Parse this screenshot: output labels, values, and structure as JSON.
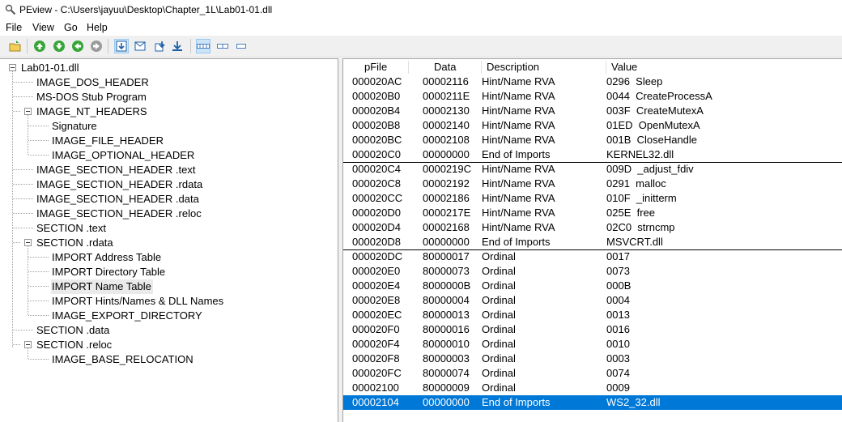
{
  "window": {
    "title": "PEview - C:\\Users\\jayuu\\Desktop\\Chapter_1L\\Lab01-01.dll"
  },
  "menu": [
    "File",
    "View",
    "Go",
    "Help"
  ],
  "toolbar": {
    "icons": [
      "open-icon",
      "home-icon",
      "down-icon",
      "back-icon",
      "forward-icon",
      "view-bytes-icon",
      "view-words-icon",
      "view-dwords-icon",
      "view-qwords-icon",
      "layout-wide-icon",
      "layout-medium-icon",
      "layout-narrow-icon"
    ]
  },
  "tree": {
    "root": "Lab01-01.dll",
    "items": [
      {
        "label": "IMAGE_DOS_HEADER",
        "level": 1
      },
      {
        "label": "MS-DOS Stub Program",
        "level": 1
      },
      {
        "label": "IMAGE_NT_HEADERS",
        "level": 1,
        "expanded": true
      },
      {
        "label": "Signature",
        "level": 2
      },
      {
        "label": "IMAGE_FILE_HEADER",
        "level": 2
      },
      {
        "label": "IMAGE_OPTIONAL_HEADER",
        "level": 2
      },
      {
        "label": "IMAGE_SECTION_HEADER .text",
        "level": 1
      },
      {
        "label": "IMAGE_SECTION_HEADER .rdata",
        "level": 1
      },
      {
        "label": "IMAGE_SECTION_HEADER .data",
        "level": 1
      },
      {
        "label": "IMAGE_SECTION_HEADER .reloc",
        "level": 1
      },
      {
        "label": "SECTION .text",
        "level": 1
      },
      {
        "label": "SECTION .rdata",
        "level": 1,
        "expanded": true
      },
      {
        "label": "IMPORT Address Table",
        "level": 2
      },
      {
        "label": "IMPORT Directory Table",
        "level": 2
      },
      {
        "label": "IMPORT Name Table",
        "level": 2,
        "selected": true
      },
      {
        "label": "IMPORT Hints/Names & DLL Names",
        "level": 2
      },
      {
        "label": "IMAGE_EXPORT_DIRECTORY",
        "level": 2
      },
      {
        "label": "SECTION .data",
        "level": 1
      },
      {
        "label": "SECTION .reloc",
        "level": 1,
        "expanded": true
      },
      {
        "label": "IMAGE_BASE_RELOCATION",
        "level": 2
      }
    ]
  },
  "columns": [
    "pFile",
    "Data",
    "Description",
    "Value"
  ],
  "rows": [
    {
      "pfile": "000020AC",
      "data": "00002116",
      "desc": "Hint/Name RVA",
      "value": "0296  Sleep"
    },
    {
      "pfile": "000020B0",
      "data": "0000211E",
      "desc": "Hint/Name RVA",
      "value": "0044  CreateProcessA"
    },
    {
      "pfile": "000020B4",
      "data": "00002130",
      "desc": "Hint/Name RVA",
      "value": "003F  CreateMutexA"
    },
    {
      "pfile": "000020B8",
      "data": "00002140",
      "desc": "Hint/Name RVA",
      "value": "01ED  OpenMutexA"
    },
    {
      "pfile": "000020BC",
      "data": "00002108",
      "desc": "Hint/Name RVA",
      "value": "001B  CloseHandle"
    },
    {
      "pfile": "000020C0",
      "data": "00000000",
      "desc": "End of Imports",
      "value": "KERNEL32.dll",
      "group_end": true
    },
    {
      "pfile": "000020C4",
      "data": "0000219C",
      "desc": "Hint/Name RVA",
      "value": "009D  _adjust_fdiv"
    },
    {
      "pfile": "000020C8",
      "data": "00002192",
      "desc": "Hint/Name RVA",
      "value": "0291  malloc"
    },
    {
      "pfile": "000020CC",
      "data": "00002186",
      "desc": "Hint/Name RVA",
      "value": "010F  _initterm"
    },
    {
      "pfile": "000020D0",
      "data": "0000217E",
      "desc": "Hint/Name RVA",
      "value": "025E  free"
    },
    {
      "pfile": "000020D4",
      "data": "00002168",
      "desc": "Hint/Name RVA",
      "value": "02C0  strncmp"
    },
    {
      "pfile": "000020D8",
      "data": "00000000",
      "desc": "End of Imports",
      "value": "MSVCRT.dll",
      "group_end": true
    },
    {
      "pfile": "000020DC",
      "data": "80000017",
      "desc": "Ordinal",
      "value": "0017"
    },
    {
      "pfile": "000020E0",
      "data": "80000073",
      "desc": "Ordinal",
      "value": "0073"
    },
    {
      "pfile": "000020E4",
      "data": "8000000B",
      "desc": "Ordinal",
      "value": "000B"
    },
    {
      "pfile": "000020E8",
      "data": "80000004",
      "desc": "Ordinal",
      "value": "0004"
    },
    {
      "pfile": "000020EC",
      "data": "80000013",
      "desc": "Ordinal",
      "value": "0013"
    },
    {
      "pfile": "000020F0",
      "data": "80000016",
      "desc": "Ordinal",
      "value": "0016"
    },
    {
      "pfile": "000020F4",
      "data": "80000010",
      "desc": "Ordinal",
      "value": "0010"
    },
    {
      "pfile": "000020F8",
      "data": "80000003",
      "desc": "Ordinal",
      "value": "0003"
    },
    {
      "pfile": "000020FC",
      "data": "80000074",
      "desc": "Ordinal",
      "value": "0074"
    },
    {
      "pfile": "00002100",
      "data": "80000009",
      "desc": "Ordinal",
      "value": "0009"
    },
    {
      "pfile": "00002104",
      "data": "00000000",
      "desc": "End of Imports",
      "value": "WS2_32.dll",
      "selected": true
    }
  ],
  "colors": {
    "selection": "#0078d7",
    "tree_highlight": "#eaeaea"
  }
}
